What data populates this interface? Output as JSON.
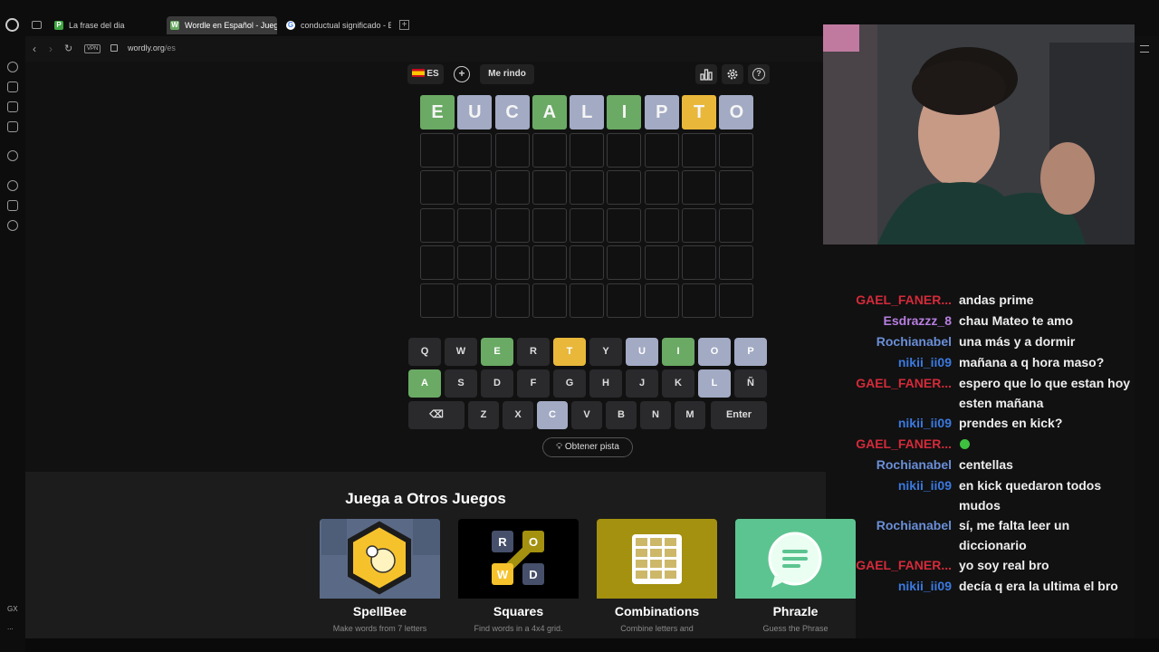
{
  "tabs": [
    {
      "label": "La frase del dia",
      "favicon": "P",
      "favcolor": "#41a644"
    },
    {
      "label": "Wordle en Español - Jueg",
      "favicon": "W",
      "favcolor": "#6aaa64"
    },
    {
      "label": "conductual significado - B",
      "favicon": "G",
      "favcolor": "#dddddd"
    }
  ],
  "address": {
    "host": "wordly.org",
    "path": "/es",
    "vpn": "VPN"
  },
  "sidebar": {
    "gx_label": "GX",
    "more_label": "..."
  },
  "toolbar": {
    "lang": "ES",
    "giveup": "Me rindo"
  },
  "board": {
    "rows": [
      [
        "E",
        "U",
        "C",
        "A",
        "L",
        "I",
        "P",
        "T",
        "O"
      ],
      [
        "",
        "",
        "",
        "",
        "",
        "",
        "",
        "",
        ""
      ],
      [
        "",
        "",
        "",
        "",
        "",
        "",
        "",
        "",
        ""
      ],
      [
        "",
        "",
        "",
        "",
        "",
        "",
        "",
        "",
        ""
      ],
      [
        "",
        "",
        "",
        "",
        "",
        "",
        "",
        "",
        ""
      ],
      [
        "",
        "",
        "",
        "",
        "",
        "",
        "",
        "",
        ""
      ]
    ],
    "states": [
      [
        "g",
        "p",
        "p",
        "g",
        "p",
        "g",
        "p",
        "y",
        "p"
      ]
    ]
  },
  "keyboard": {
    "row1": [
      {
        "k": "Q",
        "s": ""
      },
      {
        "k": "W",
        "s": ""
      },
      {
        "k": "E",
        "s": "g"
      },
      {
        "k": "R",
        "s": ""
      },
      {
        "k": "T",
        "s": "y"
      },
      {
        "k": "Y",
        "s": ""
      },
      {
        "k": "U",
        "s": "p"
      },
      {
        "k": "I",
        "s": "g"
      },
      {
        "k": "O",
        "s": "p"
      },
      {
        "k": "P",
        "s": "p"
      }
    ],
    "row2": [
      {
        "k": "A",
        "s": "g"
      },
      {
        "k": "S",
        "s": ""
      },
      {
        "k": "D",
        "s": ""
      },
      {
        "k": "F",
        "s": ""
      },
      {
        "k": "G",
        "s": ""
      },
      {
        "k": "H",
        "s": ""
      },
      {
        "k": "J",
        "s": ""
      },
      {
        "k": "K",
        "s": ""
      },
      {
        "k": "L",
        "s": "p"
      },
      {
        "k": "Ñ",
        "s": ""
      }
    ],
    "row3": [
      {
        "k": "⌫",
        "s": ""
      },
      {
        "k": "Z",
        "s": ""
      },
      {
        "k": "X",
        "s": ""
      },
      {
        "k": "C",
        "s": "p"
      },
      {
        "k": "V",
        "s": ""
      },
      {
        "k": "B",
        "s": ""
      },
      {
        "k": "N",
        "s": ""
      },
      {
        "k": "M",
        "s": ""
      },
      {
        "k": "Enter",
        "s": ""
      }
    ]
  },
  "hint_label": "Obtener pista",
  "games": {
    "heading": "Juega a Otros Juegos",
    "items": [
      {
        "title": "SpellBee",
        "desc": "Make words from 7 letters",
        "color": "#5a6a86"
      },
      {
        "title": "Squares",
        "desc": "Find words in a 4x4 grid.",
        "color": "#000000"
      },
      {
        "title": "Combinations",
        "desc": "Combine letters and",
        "color": "#a3910f"
      },
      {
        "title": "Phrazle",
        "desc": "Guess the Phrase",
        "color": "#5cc490"
      }
    ],
    "squares_letters": [
      "R",
      "O",
      "W",
      "D"
    ]
  },
  "chat": [
    {
      "user": "GAEL_FANER...",
      "color": "#d42a3a",
      "text": "andas prime"
    },
    {
      "user": "Esdrazzz_8",
      "color": "#b77ee0",
      "text": "chau Mateo te amo"
    },
    {
      "user": "Rochianabel",
      "color": "#6a8fd8",
      "text": "una más y a dormir"
    },
    {
      "user": "nikii_ii09",
      "color": "#3b79e0",
      "text": "mañana a q hora maso?"
    },
    {
      "user": "GAEL_FANER...",
      "color": "#d42a3a",
      "text": "espero que lo que estan hoy esten mañana"
    },
    {
      "user": "nikii_ii09",
      "color": "#3b79e0",
      "text": "prendes en kick?"
    },
    {
      "user": "GAEL_FANER...",
      "color": "#d42a3a",
      "text": ""
    },
    {
      "user": "Rochianabel",
      "color": "#6a8fd8",
      "text": "centellas"
    },
    {
      "user": "nikii_ii09",
      "color": "#3b79e0",
      "text": "en kick quedaron todos mudos"
    },
    {
      "user": "Rochianabel",
      "color": "#6a8fd8",
      "text": "sí, me falta leer un diccionario"
    },
    {
      "user": "GAEL_FANER...",
      "color": "#d42a3a",
      "text": "yo soy real bro"
    },
    {
      "user": "nikii_ii09",
      "color": "#3b79e0",
      "text": "decía q era la ultima el bro"
    }
  ]
}
